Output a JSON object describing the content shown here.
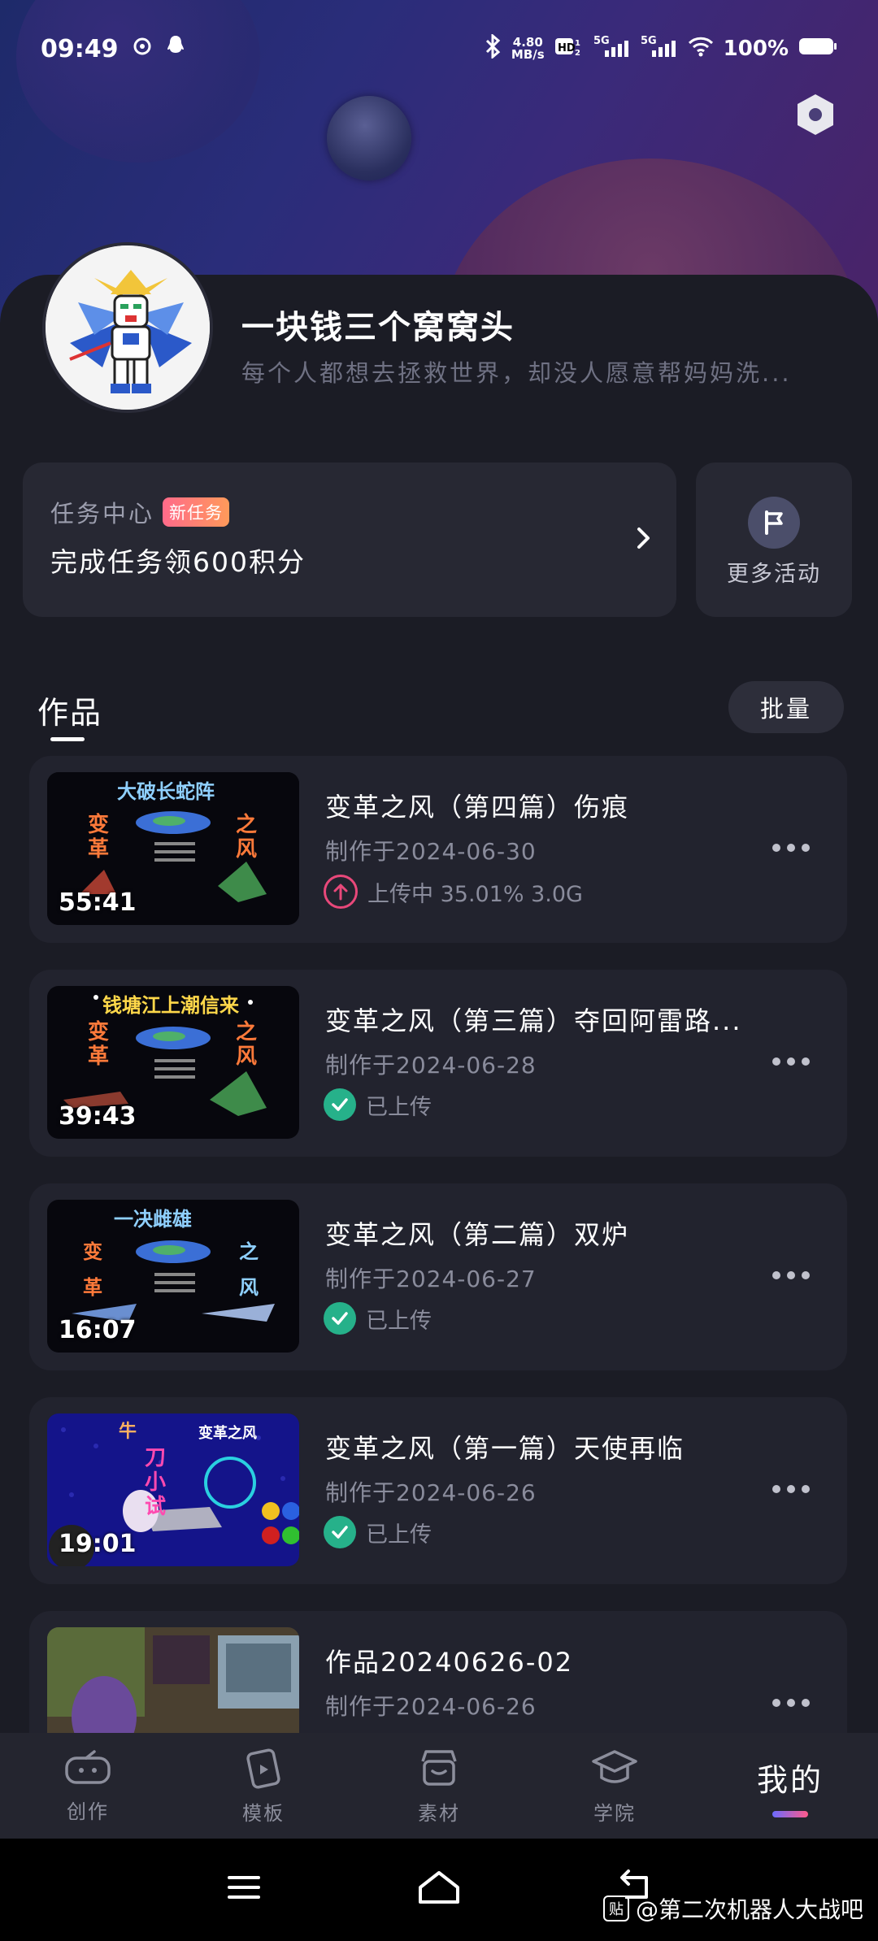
{
  "status_bar": {
    "time": "09:49",
    "net_speed": "4.80",
    "net_unit": "MB/s",
    "battery": "100%"
  },
  "profile": {
    "username": "一块钱三个窝窝头",
    "bio": "每个人都想去拯救世界，却没人愿意帮妈妈洗..."
  },
  "task_center": {
    "title": "任务中心",
    "badge": "新任务",
    "description": "完成任务领600积分"
  },
  "more_activity": {
    "label": "更多活动"
  },
  "works_section": {
    "title": "作品",
    "batch_label": "批量"
  },
  "works": [
    {
      "title": "变革之风（第四篇）伤痕",
      "date": "制作于2024-06-30",
      "duration": "55:41",
      "status": "上传中 35.01% 3.0G",
      "status_type": "uploading",
      "thumb_title": "大破长蛇阵",
      "thumb_left": "变革",
      "thumb_right": "之风"
    },
    {
      "title": "变革之风（第三篇）夺回阿雷路...",
      "date": "制作于2024-06-28",
      "duration": "39:43",
      "status": "已上传",
      "status_type": "uploaded",
      "thumb_title": "钱塘江上潮信来",
      "thumb_left": "变革",
      "thumb_right": "之风"
    },
    {
      "title": "变革之风（第二篇）双炉",
      "date": "制作于2024-06-27",
      "duration": "16:07",
      "status": "已上传",
      "status_type": "uploaded",
      "thumb_title": "一决雌雄",
      "thumb_left": "变革",
      "thumb_right": "之风"
    },
    {
      "title": "变革之风（第一篇）天使再临",
      "date": "制作于2024-06-26",
      "duration": "19:01",
      "status": "已上传",
      "status_type": "uploaded",
      "thumb_title": "变革之风",
      "thumb_left": "刀小试",
      "thumb_right": "牛"
    },
    {
      "title": "作品20240626-02",
      "date": "制作于2024-06-26",
      "duration": "",
      "status": "",
      "status_type": "none"
    }
  ],
  "tab_bar": {
    "create": "创作",
    "template": "模板",
    "material": "素材",
    "academy": "学院",
    "mine": "我的"
  },
  "watermark": {
    "text": "@第二次机器人大战吧",
    "icon": "贴"
  },
  "colors": {
    "accent_pink": "#e8487a",
    "success_green": "#26b18a",
    "card_bg": "#22232e"
  }
}
